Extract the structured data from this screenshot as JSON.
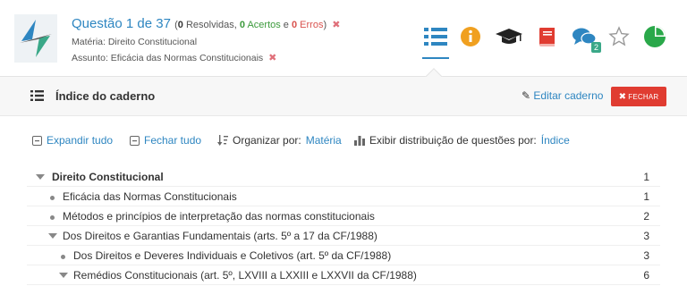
{
  "header": {
    "question": "Questão 1 de 37",
    "stats": {
      "open": "(",
      "resolved_count": "0",
      "resolved_label": " Resolvidas, ",
      "correct_count": "0",
      "correct_label": " Acertos",
      "connector": " e ",
      "errors_count": "0",
      "errors_label": " Erros",
      "close": ")"
    },
    "subject_line": "Matéria: Direito Constitucional",
    "topic_line": "Assunto: Eficácia das Normas Constitucionais",
    "icons": [
      "list-icon",
      "info-icon",
      "graduation-cap-icon",
      "book-icon",
      "comments-icon",
      "star-icon",
      "pie-chart-icon"
    ],
    "comments_badge": "2",
    "colors": {
      "accent": "#2e86c1",
      "info": "#f0a020",
      "book": "#e03c31",
      "pie": "#2aa84a",
      "badge": "#3aa888"
    }
  },
  "panel": {
    "title": "Índice do caderno",
    "edit_label": "Editar caderno",
    "close_label": "FECHAR"
  },
  "controls": {
    "expand_all": "Expandir tudo",
    "collapse_all": "Fechar tudo",
    "organize_label": "Organizar por:",
    "organize_value": "Matéria",
    "distribution_label": "Exibir distribuição de questões por:",
    "distribution_value": "Índice"
  },
  "tree": [
    {
      "label": "Direito Constitucional",
      "count": "1",
      "level": 0,
      "marker": "triangle",
      "bold": true
    },
    {
      "label": "Eficácia das Normas Constitucionais",
      "count": "1",
      "level": 1,
      "marker": "dot",
      "bold": false
    },
    {
      "label": "Métodos e princípios de interpretação das normas constitucionais",
      "count": "2",
      "level": 1,
      "marker": "dot",
      "bold": false
    },
    {
      "label": "Dos Direitos e Garantias Fundamentais (arts. 5º a 17 da CF/1988)",
      "count": "3",
      "level": 1,
      "marker": "triangle",
      "bold": false
    },
    {
      "label": "Dos Direitos e Deveres Individuais e Coletivos (art. 5º da CF/1988)",
      "count": "3",
      "level": 2,
      "marker": "dot",
      "bold": false
    },
    {
      "label": "Remédios Constitucionais (art. 5º, LXVIII a LXXIII e LXXVII da CF/1988)",
      "count": "6",
      "level": 2,
      "marker": "triangle",
      "bold": false
    }
  ]
}
